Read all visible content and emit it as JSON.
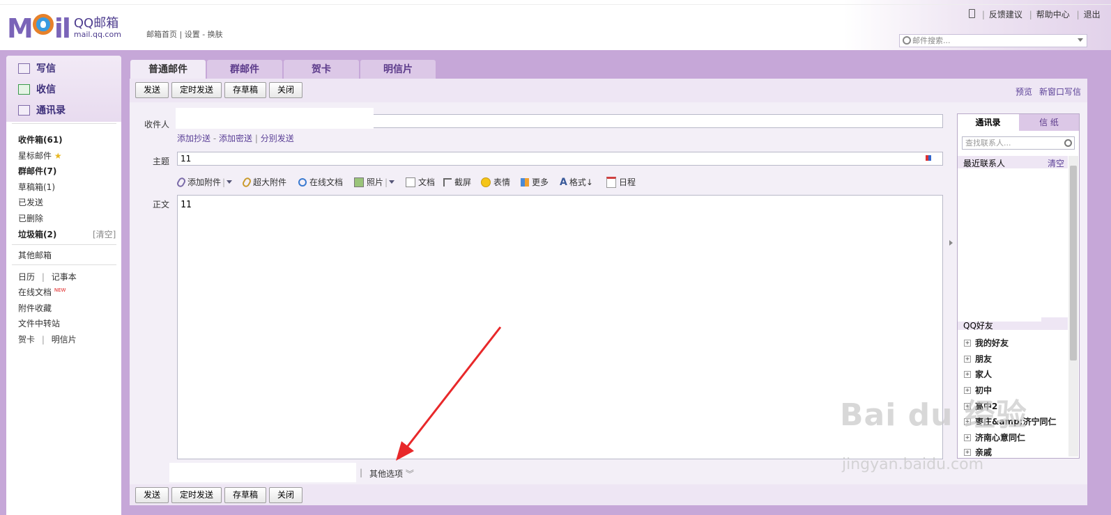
{
  "header": {
    "logo_mark": "MOil",
    "logo_title": "QQ邮箱",
    "logo_domain": "mail.qq.com",
    "left_links": "邮箱首页 | 设置 - 换肤",
    "right_links": [
      "反馈建议",
      "帮助中心",
      "退出"
    ],
    "search_placeholder": "邮件搜索..."
  },
  "sidebar": {
    "nav": [
      "写信",
      "收信",
      "通讯录"
    ],
    "folders": [
      {
        "label": "收件箱(61)",
        "bold": true
      },
      {
        "label": "星标邮件",
        "bold": false
      },
      {
        "label": "群邮件(7)",
        "bold": true
      },
      {
        "label": "草稿箱(1)",
        "bold": false
      },
      {
        "label": "已发送",
        "bold": false
      },
      {
        "label": "已删除",
        "bold": false
      },
      {
        "label": "垃圾箱(2)",
        "bold": true
      }
    ],
    "trash_clear": "[清空]",
    "other_mailbox": "其他邮箱",
    "calendar": "日历",
    "notes": "记事本",
    "online_docs": "在线文档",
    "new_badge": "NEW",
    "attachments": "附件收藏",
    "file_transfer": "文件中转站",
    "greeting_card": "贺卡",
    "postcard": "明信片"
  },
  "tabs": [
    "普通邮件",
    "群邮件",
    "贺卡",
    "明信片"
  ],
  "toolbar": {
    "send": "发送",
    "scheduled_send": "定时发送",
    "save_draft": "存草稿",
    "close": "关闭",
    "preview": "预览",
    "new_window": "新窗口写信"
  },
  "compose": {
    "to_label": "收件人",
    "to_value": "",
    "add_cc": "添加抄送",
    "add_bcc": "添加密送",
    "separate_send": "分别发送",
    "subject_label": "主题",
    "subject_value": "11",
    "body_label": "正文",
    "body_value": "11",
    "tools": [
      "添加附件",
      "超大附件",
      "在线文档",
      "照片",
      "文档",
      "截屏",
      "表情",
      "更多",
      "格式↓",
      "日程"
    ],
    "other_options": "其他选项"
  },
  "contacts": {
    "tab_contacts": "通讯录",
    "tab_stationery": "信 纸",
    "search_placeholder": "查找联系人...",
    "recent": "最近联系人",
    "clear": "清空",
    "qq_friends": "QQ好友",
    "groups": [
      "我的好友",
      "朋友",
      "家人",
      "初中",
      "高中2",
      "枣庄&amp;济宁同仁",
      "济南心意同仁",
      "亲戚"
    ]
  },
  "watermark": {
    "logo": "Bai du 经验",
    "url": "jingyan.baidu.com"
  },
  "colors": {
    "frame": "#c6a7d8",
    "link": "#5a3f96",
    "arrow": "#e8282a"
  }
}
